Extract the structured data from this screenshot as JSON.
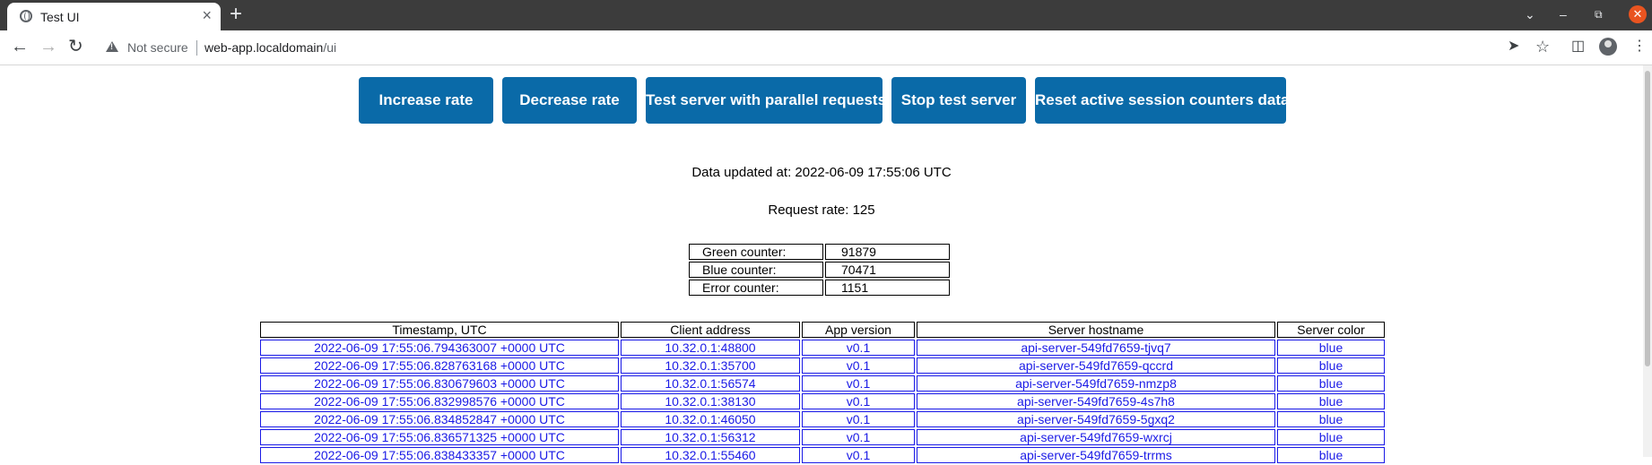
{
  "browser": {
    "tab_title": "Test UI",
    "tab_close": "×",
    "new_tab": "+",
    "security_label": "Not secure",
    "url_host": "web-app.localdomain",
    "url_path": "/ui"
  },
  "actions": {
    "increase": "Increase rate",
    "decrease": "Decrease rate",
    "parallel": "Test server with parallel requests",
    "stop": "Stop test server",
    "reset": "Reset active session counters data"
  },
  "status": {
    "updated": "Data updated at: 2022-06-09 17:55:06 UTC",
    "rate": "Request rate: 125"
  },
  "counters": [
    {
      "label": "Green counter:",
      "value": "91879"
    },
    {
      "label": "Blue counter:",
      "value": "70471"
    },
    {
      "label": "Error counter:",
      "value": "1151"
    }
  ],
  "log": {
    "columns": [
      "Timestamp, UTC",
      "Client address",
      "App version",
      "Server hostname",
      "Server color"
    ],
    "rows": [
      [
        "2022-06-09 17:55:06.794363007 +0000 UTC",
        "10.32.0.1:48800",
        "v0.1",
        "api-server-549fd7659-tjvq7",
        "blue"
      ],
      [
        "2022-06-09 17:55:06.828763168 +0000 UTC",
        "10.32.0.1:35700",
        "v0.1",
        "api-server-549fd7659-qccrd",
        "blue"
      ],
      [
        "2022-06-09 17:55:06.830679603 +0000 UTC",
        "10.32.0.1:56574",
        "v0.1",
        "api-server-549fd7659-nmzp8",
        "blue"
      ],
      [
        "2022-06-09 17:55:06.832998576 +0000 UTC",
        "10.32.0.1:38130",
        "v0.1",
        "api-server-549fd7659-4s7h8",
        "blue"
      ],
      [
        "2022-06-09 17:55:06.834852847 +0000 UTC",
        "10.32.0.1:46050",
        "v0.1",
        "api-server-549fd7659-5gxq2",
        "blue"
      ],
      [
        "2022-06-09 17:55:06.836571325 +0000 UTC",
        "10.32.0.1:56312",
        "v0.1",
        "api-server-549fd7659-wxrcj",
        "blue"
      ],
      [
        "2022-06-09 17:55:06.838433357 +0000 UTC",
        "10.32.0.1:55460",
        "v0.1",
        "api-server-549fd7659-trrms",
        "blue"
      ]
    ]
  },
  "colors": {
    "button_bg": "#0a6aa8",
    "log_text": "#1a1ae6",
    "tabbar_bg": "#3c3c3c",
    "close_button": "#e95420"
  }
}
